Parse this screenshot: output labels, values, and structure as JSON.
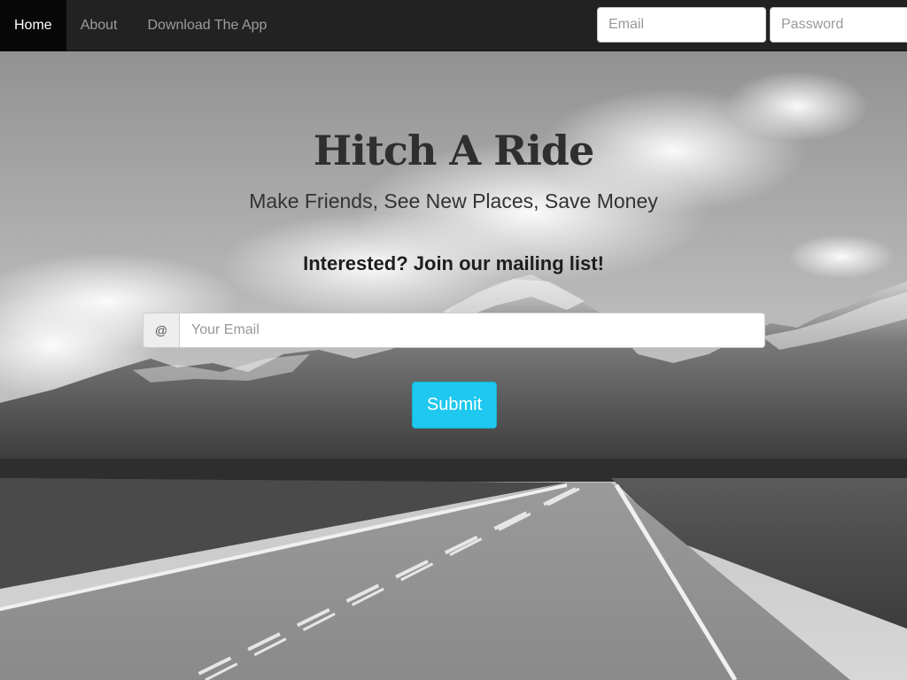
{
  "nav": {
    "items": [
      {
        "label": "Home",
        "active": true
      },
      {
        "label": "About",
        "active": false
      },
      {
        "label": "Download The App",
        "active": false
      }
    ],
    "login": {
      "email_placeholder": "Email",
      "password_placeholder": "Password"
    }
  },
  "hero": {
    "title": "Hitch A Ride",
    "subtitle": "Make Friends, See New Places, Save Money",
    "cta": "Interested? Join our mailing list!",
    "email_addon": "@",
    "email_placeholder": "Your Email",
    "submit_label": "Submit"
  },
  "colors": {
    "navbar_bg": "#222222",
    "nav_active_bg": "#080808",
    "submit_bg": "#1ec8ee"
  }
}
